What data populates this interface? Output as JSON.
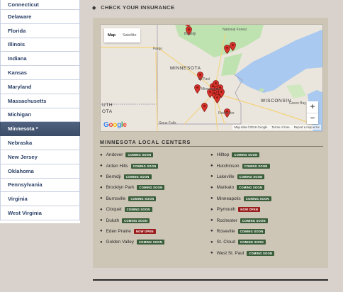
{
  "sidebar": {
    "items": [
      {
        "label": "Connecticut"
      },
      {
        "label": "Delaware"
      },
      {
        "label": "Florida"
      },
      {
        "label": "Illinois"
      },
      {
        "label": "Indiana"
      },
      {
        "label": "Kansas"
      },
      {
        "label": "Maryland"
      },
      {
        "label": "Massachusetts"
      },
      {
        "label": "Michigan"
      },
      {
        "label": "Minnesota *"
      },
      {
        "label": "Nebraska"
      },
      {
        "label": "New Jersey"
      },
      {
        "label": "Oklahoma"
      },
      {
        "label": "Pennsylvania"
      },
      {
        "label": "Virginia"
      },
      {
        "label": "West Virginia"
      }
    ],
    "active_index": 9
  },
  "header": {
    "bullet": "◆",
    "title": "CHECK YOUR INSURANCE"
  },
  "map": {
    "toggle": {
      "map": "Map",
      "satellite": "Satellite"
    },
    "labels": {
      "bemidji": "Bemidji",
      "national_forest": "National Forest",
      "fargo": "Fargo",
      "minnesota": "MINNESOTA",
      "st_paul": "St Paul",
      "minneapolis": "Minneapolis",
      "wisconsin": "WISCONSIN",
      "green_bay": "Green Bay",
      "rochester": "Rochester",
      "sioux_falls": "Sioux Falls",
      "uth": "UTH",
      "ota": "OTA",
      "minneapolis_prefix": "Mi"
    },
    "zoom_in": "+",
    "zoom_out": "−",
    "google": [
      "G",
      "o",
      "o",
      "g",
      "l",
      "e"
    ],
    "google_colors": [
      "#4285f4",
      "#ea4335",
      "#fbbc05",
      "#4285f4",
      "#34a853",
      "#ea4335"
    ],
    "footer": {
      "data": "Map data ©2016 Google",
      "terms": "Terms of Use",
      "report": "Report a map error"
    }
  },
  "local_centers": {
    "title": "MINNESOTA LOCAL CENTERS",
    "left": [
      {
        "name": "Andover",
        "status": "COMING SOON"
      },
      {
        "name": "Arden Hills",
        "status": "COMING SOON"
      },
      {
        "name": "Bemidji",
        "status": "COMING SOON"
      },
      {
        "name": "Brooklyn Park",
        "status": "COMING SOON"
      },
      {
        "name": "Burnsville",
        "status": "COMING SOON"
      },
      {
        "name": "Cloquet",
        "status": "COMING SOON"
      },
      {
        "name": "Duluth",
        "status": "COMING SOON"
      },
      {
        "name": "Eden Prairie",
        "status": "NOW OPEN"
      },
      {
        "name": "Golden Valley",
        "status": "COMING SOON"
      }
    ],
    "right": [
      {
        "name": "Hilltop",
        "status": "COMING SOON"
      },
      {
        "name": "Hutchinson",
        "status": "COMING SOON"
      },
      {
        "name": "Lakeville",
        "status": "COMING SOON"
      },
      {
        "name": "Mankato",
        "status": "COMING SOON"
      },
      {
        "name": "Minneapolis",
        "status": "COMING SOON"
      },
      {
        "name": "Plymouth",
        "status": "NOW OPEN"
      },
      {
        "name": "Rochester",
        "status": "COMING SOON"
      },
      {
        "name": "Roseville",
        "status": "COMING SOON"
      },
      {
        "name": "St. Cloud",
        "status": "COMING SOON"
      },
      {
        "name": "West St. Paul",
        "status": "COMING SOON"
      }
    ],
    "bullet": "●"
  },
  "colors": {
    "accent_nav": "#3c4d69",
    "coming_soon": "#3b5e3a",
    "now_open": "#9b1c1c",
    "panel": "#cdc5b6"
  }
}
